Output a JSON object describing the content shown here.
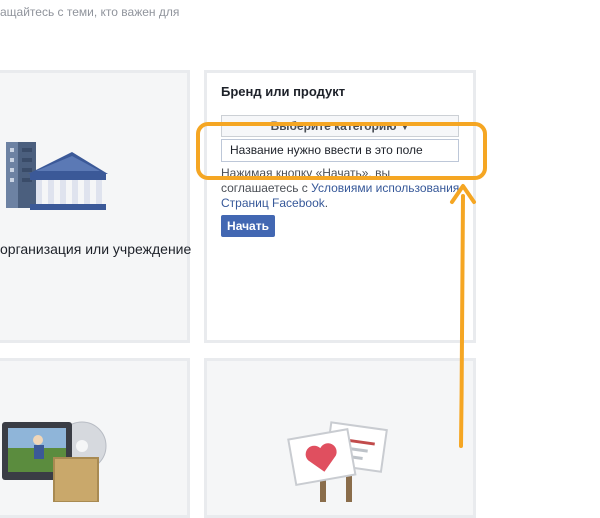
{
  "header": {
    "subtitle_fragment": "ащайтесь с теми, кто важен для"
  },
  "cards": {
    "org": {
      "label": "организация или учреждение",
      "icon": "building-icon"
    },
    "brand": {
      "title": "Бренд или продукт",
      "category_select": "Выберите категорию",
      "name_input_value": "Название нужно ввести в это поле",
      "terms_prefix": "Нажимая кнопку «Начать», вы соглашаетесь с ",
      "terms_link": "Условиями использования Страниц Facebook",
      "terms_suffix": ".",
      "start_button": "Начать"
    },
    "entertainment": {
      "icon": "tv-cd-icon"
    },
    "cause": {
      "icon": "signs-heart-icon"
    }
  },
  "annotation": {
    "highlight_color": "#f5a623"
  }
}
